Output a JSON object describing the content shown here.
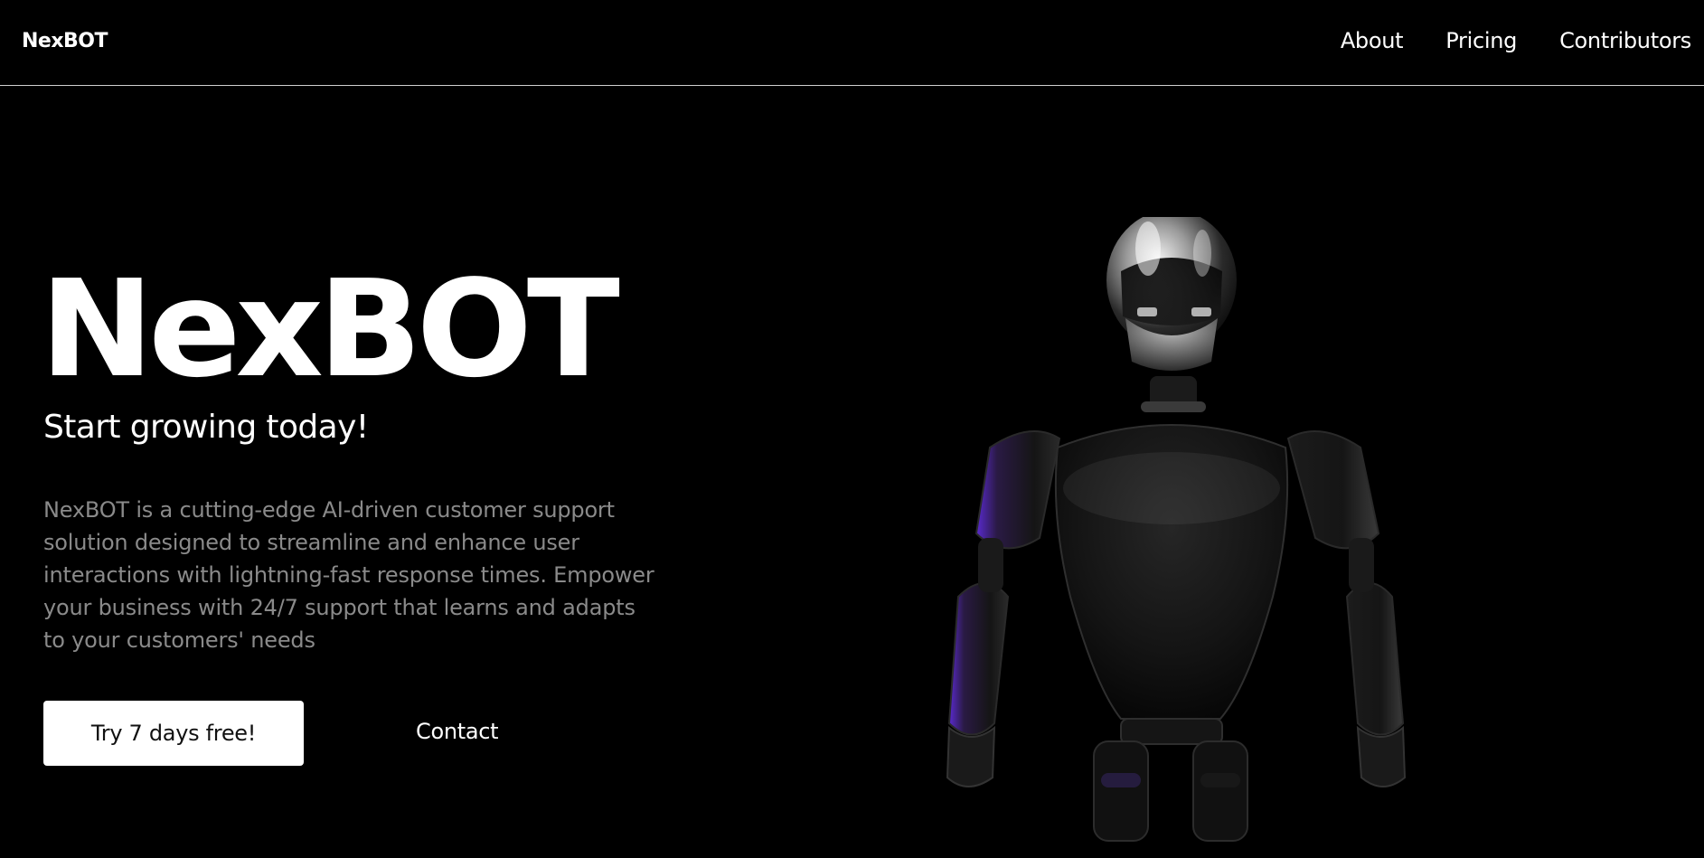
{
  "nav": {
    "brand": "NexBOT",
    "links": [
      "About",
      "Pricing",
      "Contributors"
    ]
  },
  "hero": {
    "title": "NexBOT",
    "subtitle": "Start growing today!",
    "description": "NexBOT is a cutting-edge AI-driven customer support solution designed to streamline and enhance user interactions with lightning-fast response times. Empower your business with 24/7 support that learns and adapts to your customers' needs",
    "cta_label": "Try 7 days free!",
    "contact_label": "Contact"
  },
  "colors": {
    "background": "#000000",
    "text": "#ffffff",
    "muted": "#8a8a8a",
    "accent_glow": "#6a2cff"
  }
}
